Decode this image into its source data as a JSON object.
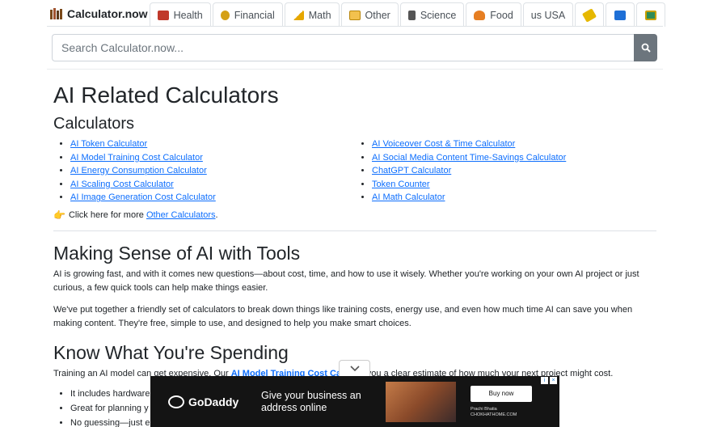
{
  "brand": {
    "name": "Calculator.now",
    "icon": "books-icon"
  },
  "tabs": [
    {
      "label": "Health",
      "icon": "health-icon",
      "color": "#c0392b"
    },
    {
      "label": "Financial",
      "icon": "money-bag-icon",
      "color": "#d4a017"
    },
    {
      "label": "Math",
      "icon": "triangle-ruler-icon",
      "color": "#e6a700"
    },
    {
      "label": "Other",
      "icon": "folder-icon",
      "color": "#f2c14e"
    },
    {
      "label": "Science",
      "icon": "microscope-icon",
      "color": "#555555"
    },
    {
      "label": "Food",
      "icon": "food-icon",
      "color": "#e67e22"
    },
    {
      "label": "us USA",
      "icon": "",
      "color": ""
    },
    {
      "label": "",
      "icon": "tag-icon",
      "color": "#e6b800"
    },
    {
      "label": "",
      "icon": "id-card-icon",
      "color": "#1e6fd6"
    },
    {
      "label": "",
      "icon": "ledger-icon",
      "color": "#2e8b57"
    }
  ],
  "search": {
    "placeholder": "Search Calculator.now..."
  },
  "page": {
    "title": "AI Related Calculators",
    "subtitle": "Calculators",
    "left_links": [
      "AI Token Calculator",
      "AI Model Training Cost Calculator",
      "AI Energy Consumption Calculator",
      "AI Scaling Cost Calculator",
      "AI Image Generation Cost Calculator"
    ],
    "right_links": [
      "AI Voiceover Cost & Time Calculator",
      "AI Social Media Content Time-Savings Calculator",
      "ChatGPT Calculator",
      "Token Counter",
      "AI Math Calculator"
    ],
    "more_prefix": "Click here for more ",
    "more_link": "Other Calculators",
    "more_suffix": "."
  },
  "section1": {
    "heading": "Making Sense of AI with Tools",
    "p1": "AI is growing fast, and with it comes new questions—about cost, time, and how to use it wisely. Whether you're working on your own AI project or just curious, a few quick tools can help make things easier.",
    "p2": "We've put together a friendly set of calculators to break down things like training costs, energy use, and even how much time AI can save you when making content. They're free, simple to use, and designed to help you make smart choices."
  },
  "section2": {
    "heading": "Know What You're Spending",
    "p_prefix": "Training an AI model can get expensive. Our ",
    "p_link": "AI Model Training Cost Ca",
    "p_suffix": " gives you a clear estimate of how much your next project might cost.",
    "bullets": [
      "It includes hardware",
      "Great for planning y",
      "No guessing—just e"
    ]
  },
  "ad": {
    "brand": "GoDaddy",
    "message": "Give your business an address online",
    "cta": "Buy now",
    "credit_name": "Prachi Bhatia",
    "credit_site": "CHOKHATHOME.COM"
  }
}
